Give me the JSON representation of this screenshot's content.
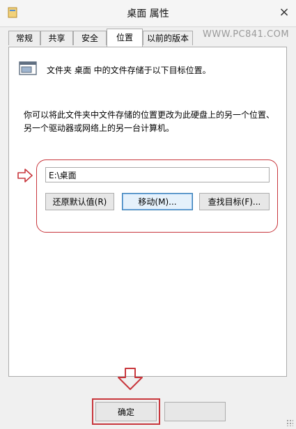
{
  "window": {
    "title": "桌面 属性",
    "close_glyph": "×"
  },
  "watermark": "WWW.PC841.COM",
  "tabs": [
    {
      "label": "常规",
      "active": false
    },
    {
      "label": "共享",
      "active": false
    },
    {
      "label": "安全",
      "active": false
    },
    {
      "label": "位置",
      "active": true
    },
    {
      "label": "以前的版本",
      "active": false
    }
  ],
  "panel": {
    "description": "文件夹 桌面 中的文件存储于以下目标位置。",
    "paragraph": "你可以将此文件夹中文件存储的位置更改为此硬盘上的另一个位置、另一个驱动器或网络上的另一台计算机。",
    "path_value": "E:\\桌面",
    "buttons": {
      "restore_default": "还原默认值(R)",
      "move": "移动(M)...",
      "find_target": "查找目标(F)..."
    }
  },
  "footer": {
    "ok_label": "确定"
  },
  "icons": {
    "folder": "folder-icon",
    "arrow_right": "outline-right-arrow-icon",
    "arrow_down": "outline-down-arrow-icon"
  },
  "colors": {
    "highlight_red": "#c8363c",
    "focus_blue": "#3c7fb1"
  }
}
